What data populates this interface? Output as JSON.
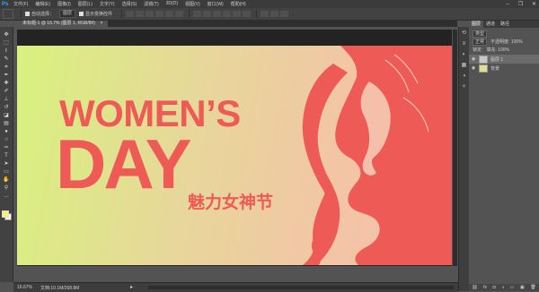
{
  "app": {
    "logo": "Ps",
    "menu": [
      "文件(F)",
      "编辑(E)",
      "图像(I)",
      "图层(L)",
      "文字(Y)",
      "选择(S)",
      "滤镜(T)",
      "3D(D)",
      "视图(V)",
      "窗口(W)",
      "帮助(H)"
    ],
    "window_controls": [
      "–",
      "❐",
      "✕"
    ]
  },
  "options_bar": {
    "auto_select_label": "自动选择：",
    "auto_select_value": "图层",
    "show_transform_label": "显示变换控件"
  },
  "document": {
    "tab_title": "未标题-1 @ 16.7% (图层 1, RGB/8#)",
    "tab_close": "×"
  },
  "artwork": {
    "line1": "WOMEN’S",
    "line2": "DAY",
    "subtitle": "魅力女神节",
    "colors": {
      "text": "#ee5a55",
      "bg_left": "#d8f27e",
      "bg_right": "#f6bfae"
    }
  },
  "status": {
    "zoom": "16.67%",
    "doc_size": "文档:10.1M/268.8M",
    "arrow": "▸"
  },
  "panels": {
    "tabs": [
      "图层",
      "通道",
      "路径"
    ],
    "filter_label": "类型",
    "blend_mode": "正常",
    "opacity_label": "不透明度: 100%",
    "lock_label": "锁定:",
    "fill_label": "填充: 100%",
    "layers": [
      {
        "name": "图层 1",
        "active": true,
        "thumb_color": "#c7c7c7"
      },
      {
        "name": "背景",
        "active": false,
        "thumb_color": "#e2de8f"
      }
    ],
    "bottom_icons": [
      "link-icon",
      "fx-icon",
      "mask-icon",
      "adjust-icon",
      "folder-icon",
      "new-layer-icon",
      "trash-icon"
    ],
    "eye_glyph": "◉",
    "bottom_glyphs": [
      "⛓",
      "fx",
      "◘",
      "◑",
      "▭",
      "▣",
      "🗑"
    ]
  },
  "tools": [
    {
      "icon": "move-icon",
      "glyph": "✥"
    },
    {
      "icon": "marquee-icon",
      "glyph": "⬚"
    },
    {
      "icon": "lasso-icon",
      "glyph": "ℓ"
    },
    {
      "icon": "quick-select-icon",
      "glyph": "✎"
    },
    {
      "icon": "crop-icon",
      "glyph": "⌗"
    },
    {
      "icon": "eyedropper-icon",
      "glyph": "✒"
    },
    {
      "icon": "healing-icon",
      "glyph": "✚"
    },
    {
      "icon": "brush-icon",
      "glyph": "✐"
    },
    {
      "icon": "clone-stamp-icon",
      "glyph": "⊥"
    },
    {
      "icon": "history-brush-icon",
      "glyph": "↺"
    },
    {
      "icon": "eraser-icon",
      "glyph": "◪"
    },
    {
      "icon": "gradient-icon",
      "glyph": "▤"
    },
    {
      "icon": "blur-icon",
      "glyph": "●"
    },
    {
      "icon": "dodge-icon",
      "glyph": "○"
    },
    {
      "icon": "pen-icon",
      "glyph": "✑"
    },
    {
      "icon": "type-icon",
      "glyph": "T"
    },
    {
      "icon": "path-select-icon",
      "glyph": "➤"
    },
    {
      "icon": "shape-icon",
      "glyph": "▭"
    },
    {
      "icon": "hand-icon",
      "glyph": "✋"
    },
    {
      "icon": "zoom-icon",
      "glyph": "⚲"
    },
    {
      "icon": "more-icon",
      "glyph": "…"
    }
  ],
  "dock_icons": [
    {
      "icon": "history-icon",
      "glyph": "⟲"
    },
    {
      "icon": "properties-icon",
      "glyph": "≡"
    },
    {
      "icon": "color-icon",
      "glyph": "◐"
    },
    {
      "icon": "swatches-icon",
      "glyph": "▦"
    },
    {
      "icon": "adjustments-icon",
      "glyph": "◑"
    },
    {
      "icon": "styles-icon",
      "glyph": "✧"
    }
  ]
}
